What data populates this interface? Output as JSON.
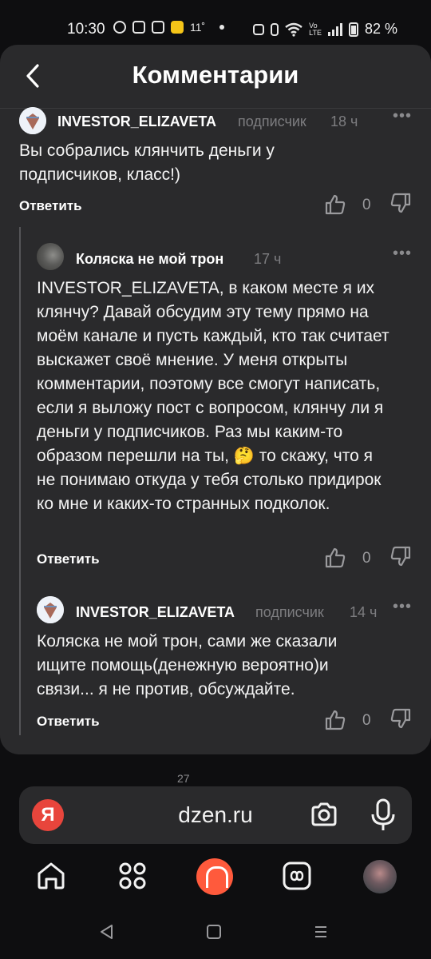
{
  "status_bar": {
    "time": "10:30",
    "temperature": "11˚",
    "battery": "82 %"
  },
  "header": {
    "title": "Комментарии"
  },
  "comments": [
    {
      "author": "INVESTOR_ELIZAVETA",
      "badge": "подписчик",
      "time": "18 ч",
      "text": "Вы собрались клянчить деньги у подписчиков, класс!)",
      "reply_label": "Ответить",
      "likes": "0"
    },
    {
      "author": "Коляска не мой трон",
      "badge": "",
      "time": "17 ч",
      "text": "INVESTOR_ELIZAVETA, в каком месте я их клянчу? Давай обсудим эту тему прямо на моём канале и пусть каждый, кто так считает выскажет своё мнение. У меня открыты комментарии, поэтому все смогут написать, если я выложу пост с вопросом, клянчу ли я деньги у подписчиков. Раз мы каким-то образом перешли на ты, 🤔 то скажу, что я не понимаю откуда у тебя столько придирок ко мне и каких-то странных подколок.",
      "reply_label": "Ответить",
      "likes": "0"
    },
    {
      "author": "INVESTOR_ELIZAVETA",
      "badge": "подписчик",
      "time": "14 ч",
      "text": "Коляска не мой трон, сами же сказали ищите помощь(денежную вероятно)и связи... я не против, обсуждайте.",
      "reply_label": "Ответить",
      "likes": "0"
    }
  ],
  "more_label": "•••",
  "page_fragment": "27",
  "browser": {
    "logo": "Я",
    "url": "dzen.ru"
  },
  "icons": {
    "back": "chevron-left-icon",
    "like": "thumb-up-icon",
    "dislike": "thumb-down-icon",
    "camera": "camera-icon",
    "mic": "microphone-icon",
    "home": "home-icon",
    "services": "grid-icon",
    "alice": "alice-icon",
    "tabs": "tabs-icon"
  },
  "colors": {
    "sheet_bg": "#2a2a2c",
    "page_bg": "#0e0e10",
    "yandex_red": "#e8453c",
    "alice_orange": "#ff5a3c"
  }
}
